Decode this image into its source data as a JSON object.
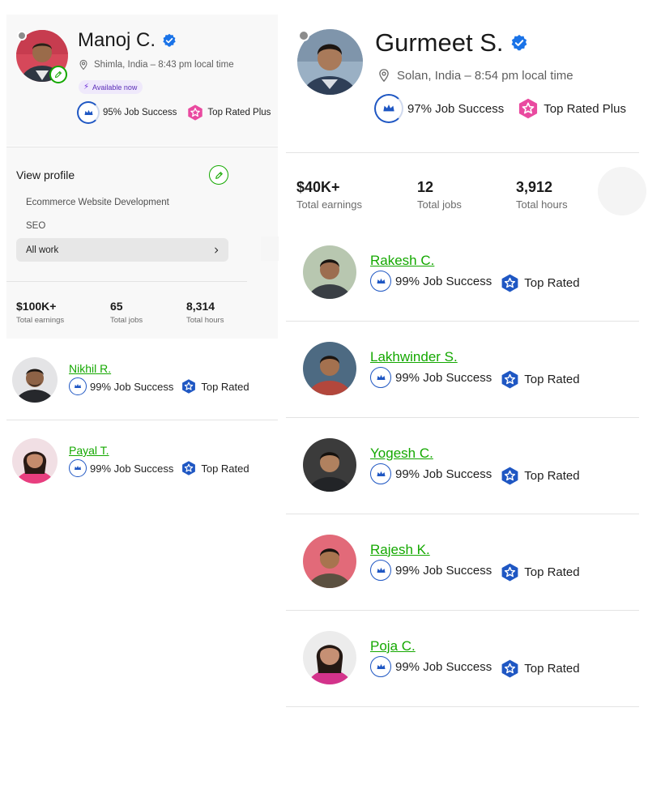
{
  "left_profile": {
    "name": "Manoj C.",
    "location": "Shimla, India – 8:43 pm local time",
    "availability": "Available now",
    "job_success": "95% Job Success",
    "badge": "Top Rated Plus",
    "view_profile_title": "View profile",
    "specializations": [
      "Ecommerce Website Development",
      "SEO"
    ],
    "all_work_label": "All work",
    "stats": [
      {
        "value": "$100K+",
        "label": "Total earnings"
      },
      {
        "value": "65",
        "label": "Total jobs"
      },
      {
        "value": "8,314",
        "label": "Total hours"
      }
    ],
    "freelancers": [
      {
        "name": "Nikhil R.",
        "job_success": "99% Job Success",
        "badge": "Top Rated"
      },
      {
        "name": "Payal T.",
        "job_success": "99% Job Success",
        "badge": "Top Rated"
      }
    ]
  },
  "right_profile": {
    "name": "Gurmeet S.",
    "location": "Solan, India – 8:54 pm local time",
    "job_success": "97% Job Success",
    "badge": "Top Rated Plus",
    "stats": [
      {
        "value": "$40K+",
        "label": "Total earnings"
      },
      {
        "value": "12",
        "label": "Total jobs"
      },
      {
        "value": "3,912",
        "label": "Total hours"
      }
    ],
    "freelancers": [
      {
        "name": "Rakesh C.",
        "job_success": "99% Job Success",
        "badge": "Top Rated"
      },
      {
        "name": "Lakhwinder S.",
        "job_success": "99% Job Success",
        "badge": "Top Rated"
      },
      {
        "name": "Yogesh C.",
        "job_success": "99% Job Success",
        "badge": "Top Rated"
      },
      {
        "name": "Rajesh K.",
        "job_success": "99% Job Success",
        "badge": "Top Rated"
      },
      {
        "name": "Poja C.",
        "job_success": "99% Job Success",
        "badge": "Top Rated"
      }
    ]
  },
  "colors": {
    "accent_green": "#14a800",
    "job_success_blue": "#1f57c3",
    "top_rated_plus_pink": "#e94aa0",
    "top_rated_blue": "#1f57c3",
    "verified_blue": "#1a73e8"
  },
  "icons": [
    "verified-icon",
    "location-pin-icon",
    "bolt-icon",
    "crown-icon",
    "star-badge-icon",
    "pencil-icon",
    "chevron-right-icon"
  ]
}
